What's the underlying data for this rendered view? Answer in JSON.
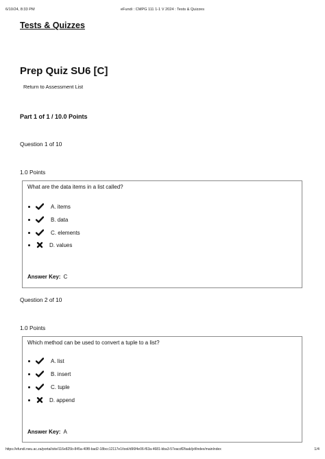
{
  "print_header": {
    "datetime": "6/10/24, 8:33 PM",
    "title": "eFundi : CMPG 111 1-1 V 2024 : Tests & Quizzes"
  },
  "print_footer": {
    "url": "https://efundi.nwu.ac.za/portal/site/116e825b-845a-40f8-bad2-18bcc12117e1/tool/d96f4e06-f63a-4681-bba3-57eacdf2faab/jsf/index/mainIndex",
    "page": "1/4"
  },
  "page_heading": "Tests & Quizzes",
  "quiz_title": "Prep Quiz SU6 [C]",
  "return_link": "Return to Assessment List",
  "part_heading": "Part 1 of 1 / 10.0 Points",
  "answer_key_label": "Answer Key:",
  "questions": [
    {
      "label": "Question 1 of 10",
      "points": "1.0 Points",
      "text": "What are the data items in a list called?",
      "choices": [
        {
          "text": "A. items",
          "icon": "check-icon"
        },
        {
          "text": "B. data",
          "icon": "check-icon"
        },
        {
          "text": "C. elements",
          "icon": "check-icon"
        },
        {
          "text": "D. values",
          "icon": "cross-icon"
        }
      ],
      "answer_key": "C"
    },
    {
      "label": "Question 2 of 10",
      "points": "1.0 Points",
      "text": "Which method can be used to convert a tuple to a list?",
      "choices": [
        {
          "text": "A. list",
          "icon": "check-icon"
        },
        {
          "text": "B. insert",
          "icon": "check-icon"
        },
        {
          "text": "C. tuple",
          "icon": "check-icon"
        },
        {
          "text": "D. append",
          "icon": "cross-icon"
        }
      ],
      "answer_key": "A"
    }
  ]
}
